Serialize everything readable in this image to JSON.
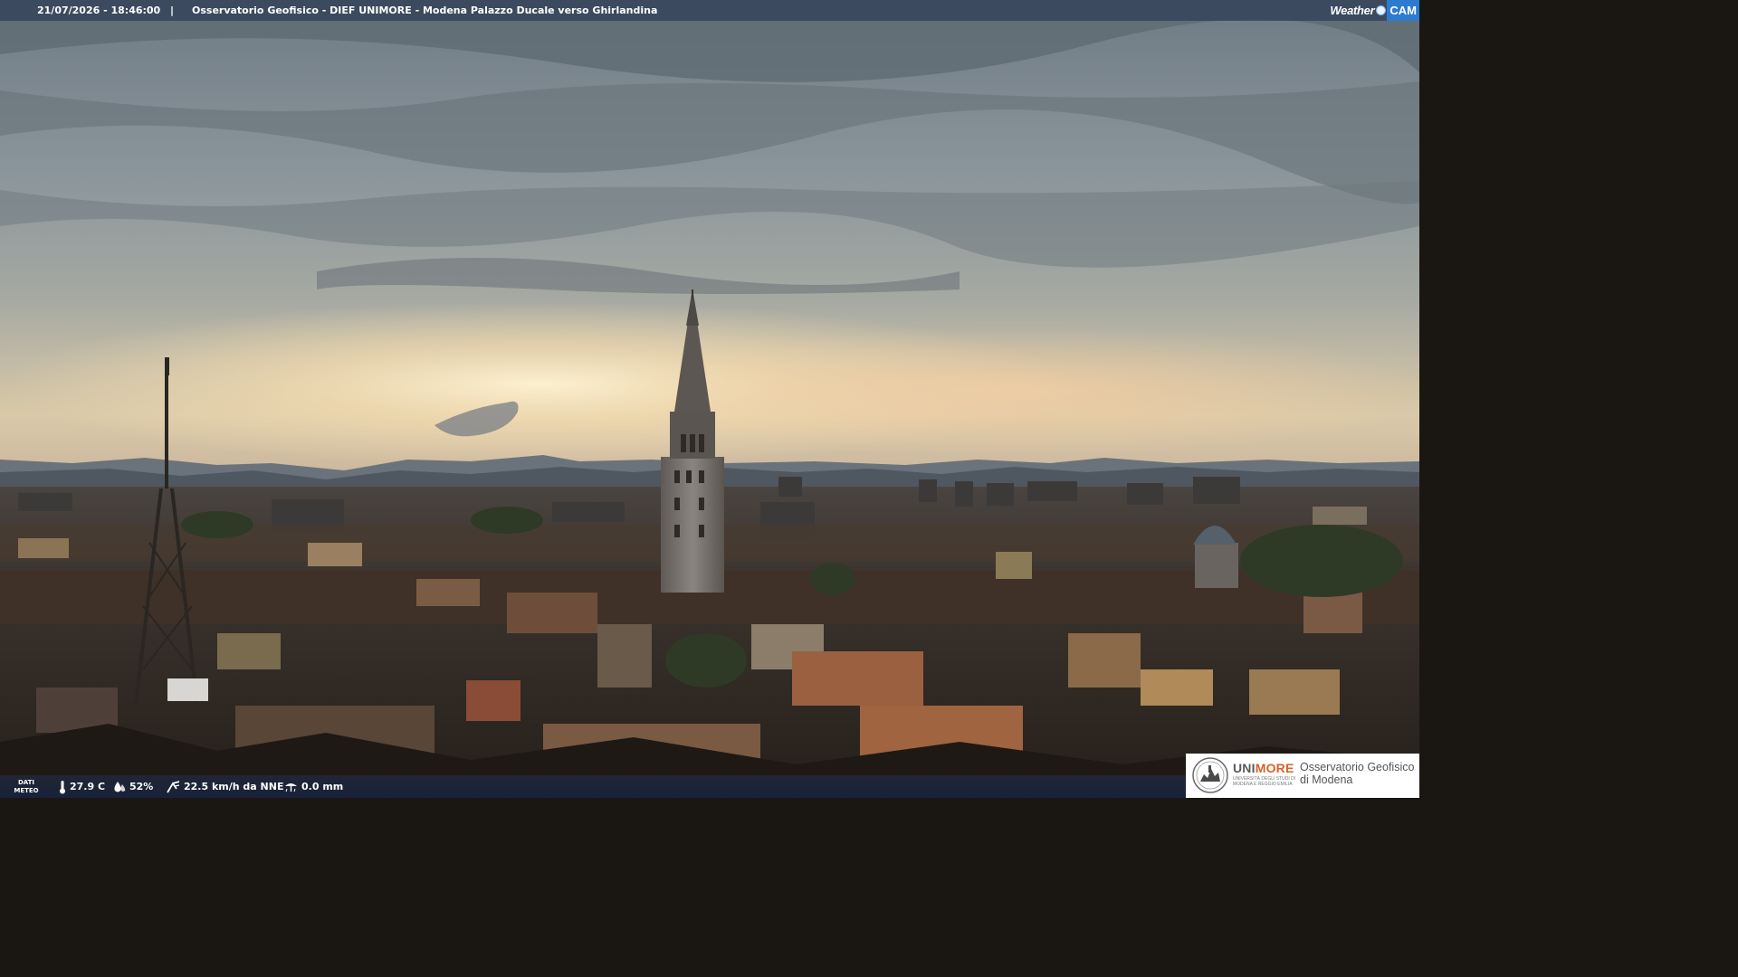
{
  "overlay_top": {
    "timestamp": "21/07/2026 - 18:46:00",
    "separator": "|",
    "title": "Osservatorio Geofisico - DIEF UNIMORE - Modena Palazzo Ducale verso Ghirlandina",
    "logo_word": "Weather",
    "logo_cam": "CAM"
  },
  "overlay_bottom": {
    "dati_label_1": "DATI",
    "dati_label_2": "METEO",
    "temperature": "27.9 C",
    "humidity": "52%",
    "wind": "22.5 km/h da NNE",
    "rain": "0.0 mm"
  },
  "institution": {
    "name_part1": "UNI",
    "name_part2": "MORE",
    "subtitle": "UNIVERSITÀ DEGLI STUDI DI MODENA E REGGIO EMILIA",
    "observatory_line1": "Osservatorio Geofisico",
    "observatory_line2": "di Modena"
  },
  "colors": {
    "topbar": "#34425c",
    "accent_orange": "#d8622a",
    "logo_blue": "#2c7bd0"
  },
  "icons": {
    "temperature": "thermometer-icon",
    "humidity": "humidity-drop-icon",
    "wind": "wind-icon",
    "rain": "rain-icon"
  }
}
